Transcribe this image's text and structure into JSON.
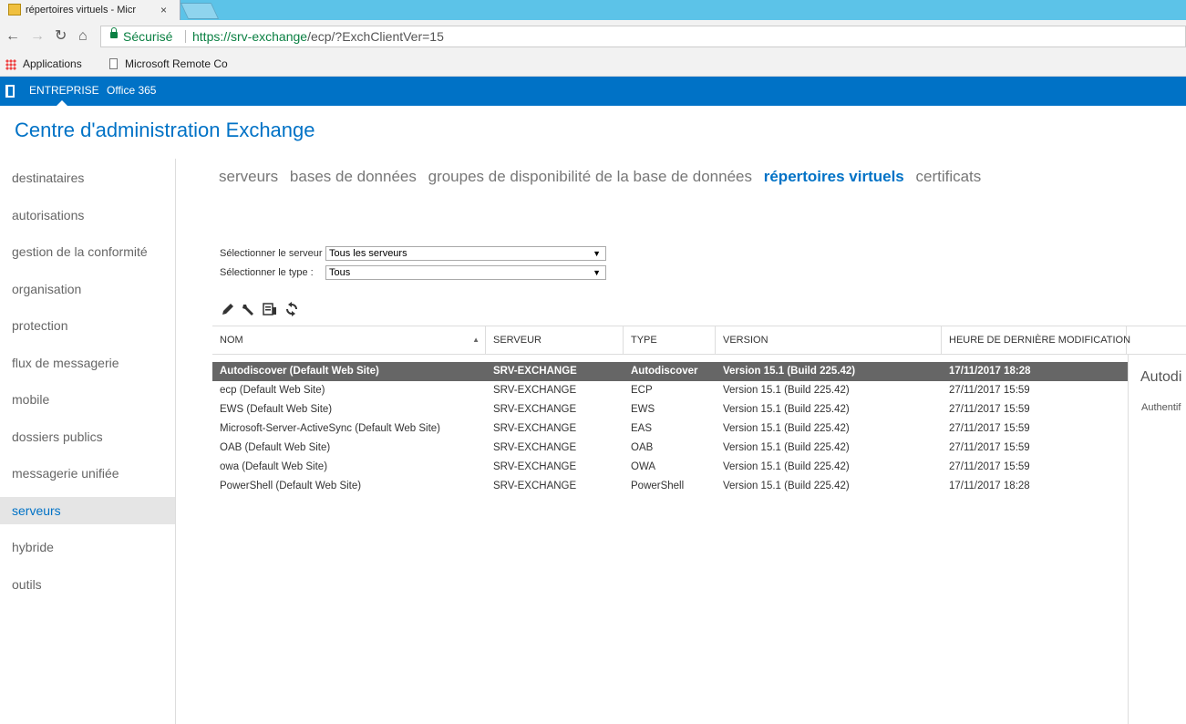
{
  "browser": {
    "tab_title": "répertoires virtuels - Micr",
    "tab_close": "×",
    "secure_label": "Sécurisé",
    "url_host": "https://srv-exchange",
    "url_path": "/ecp/?ExchClientVer=15",
    "bookmarks": [
      "Applications",
      "Microsoft Remote Co"
    ]
  },
  "o365": {
    "items": [
      "ENTREPRISE",
      "Office 365"
    ]
  },
  "app_title": "Centre d'administration Exchange",
  "left_nav": [
    "destinataires",
    "autorisations",
    "gestion de la conformité",
    "organisation",
    "protection",
    "flux de messagerie",
    "mobile",
    "dossiers publics",
    "messagerie unifiée",
    "serveurs",
    "hybride",
    "outils"
  ],
  "left_nav_active": "serveurs",
  "sub_tabs": [
    "serveurs",
    "bases de données",
    "groupes de disponibilité de la base de données",
    "répertoires virtuels",
    "certificats"
  ],
  "sub_tab_active": "répertoires virtuels",
  "filters": {
    "server_label": "Sélectionner le serveur :",
    "server_value": "Tous les serveurs",
    "type_label": "Sélectionner le type :",
    "type_value": "Tous"
  },
  "toolbar": [
    "edit-icon",
    "wrench-icon",
    "details-icon",
    "refresh-icon"
  ],
  "grid": {
    "columns": [
      "NOM",
      "SERVEUR",
      "TYPE",
      "VERSION",
      "HEURE DE DERNIÈRE MODIFICATION"
    ],
    "sort_indicator": "▲",
    "rows": [
      [
        "Autodiscover (Default Web Site)",
        "SRV-EXCHANGE",
        "Autodiscover",
        "Version 15.1 (Build 225.42)",
        "17/11/2017 18:28"
      ],
      [
        "ecp (Default Web Site)",
        "SRV-EXCHANGE",
        "ECP",
        "Version 15.1 (Build 225.42)",
        "27/11/2017 15:59"
      ],
      [
        "EWS (Default Web Site)",
        "SRV-EXCHANGE",
        "EWS",
        "Version 15.1 (Build 225.42)",
        "27/11/2017 15:59"
      ],
      [
        "Microsoft-Server-ActiveSync (Default Web Site)",
        "SRV-EXCHANGE",
        "EAS",
        "Version 15.1 (Build 225.42)",
        "27/11/2017 15:59"
      ],
      [
        "OAB (Default Web Site)",
        "SRV-EXCHANGE",
        "OAB",
        "Version 15.1 (Build 225.42)",
        "27/11/2017 15:59"
      ],
      [
        "owa (Default Web Site)",
        "SRV-EXCHANGE",
        "OWA",
        "Version 15.1 (Build 225.42)",
        "27/11/2017 15:59"
      ],
      [
        "PowerShell (Default Web Site)",
        "SRV-EXCHANGE",
        "PowerShell",
        "Version 15.1 (Build 225.42)",
        "17/11/2017 18:28"
      ]
    ],
    "selected_row": 0
  },
  "details": {
    "title": "Autodi",
    "subtitle": "Authentif"
  },
  "colors": {
    "brand_blue": "#0072c6",
    "selected_row": "#666666",
    "secure_green": "#0b8043"
  }
}
